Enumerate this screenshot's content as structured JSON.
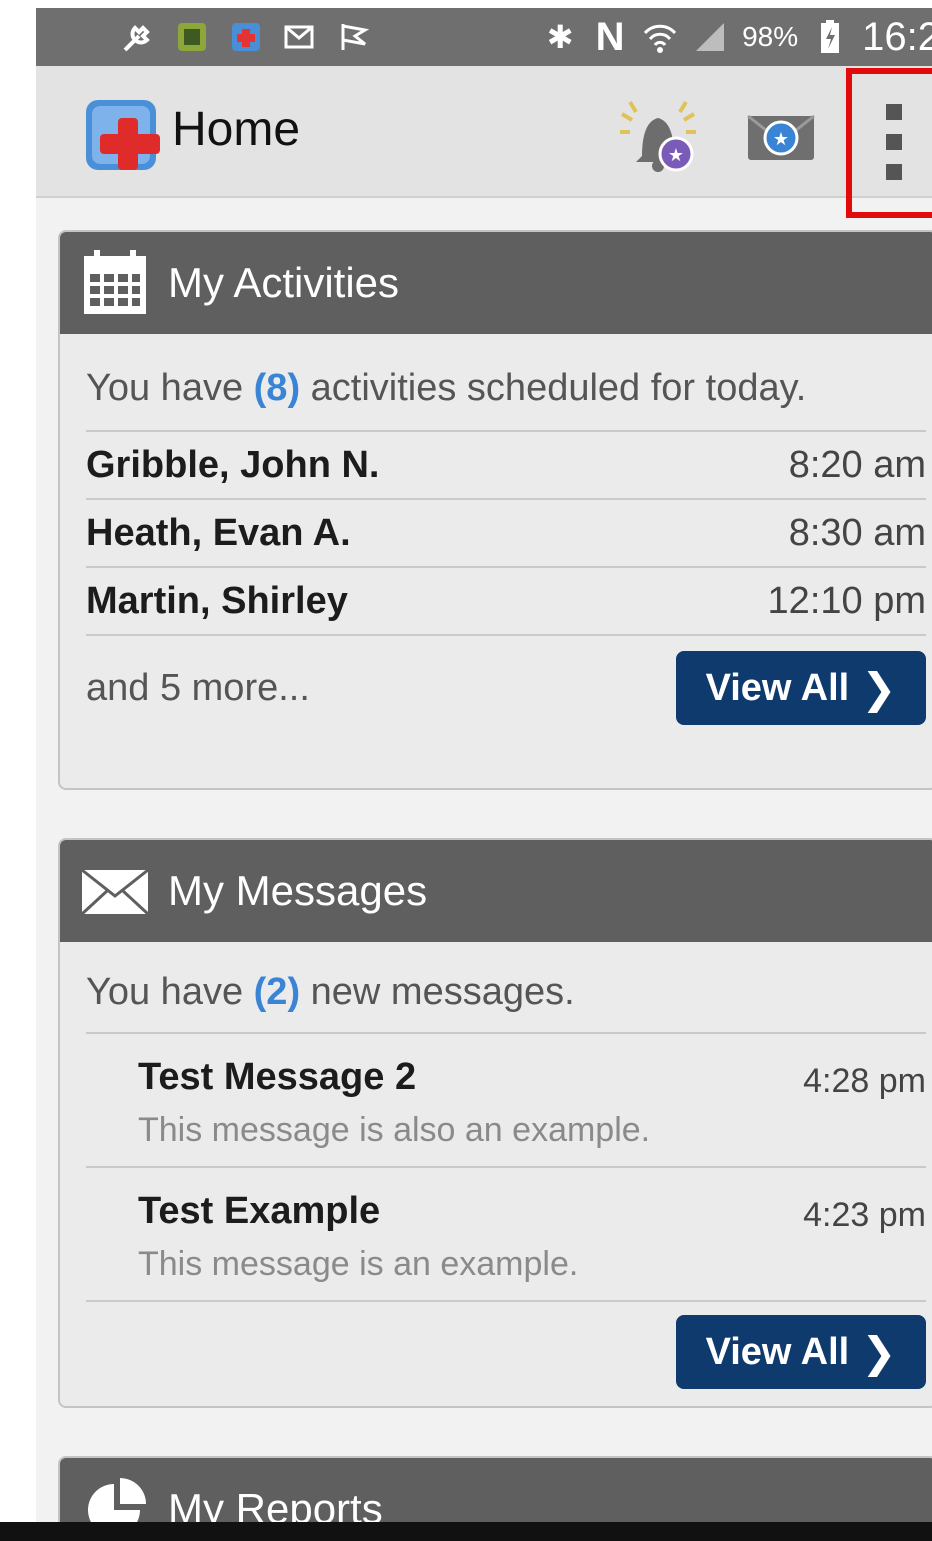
{
  "status_bar": {
    "battery": "98%",
    "time": "16:2"
  },
  "action_bar": {
    "title": "Home",
    "alerts_icon": "bell-alert-icon",
    "messages_icon": "mail-icon",
    "overflow_icon": "more-vertical-icon"
  },
  "activities": {
    "title": "My Activities",
    "summary_prefix": "You have ",
    "summary_count": "(8)",
    "summary_suffix": " activities scheduled for today.",
    "items": [
      {
        "name": "Gribble, John N.",
        "time": "8:20 am"
      },
      {
        "name": "Heath, Evan A.",
        "time": "8:30 am"
      },
      {
        "name": "Martin, Shirley",
        "time": "12:10 pm"
      }
    ],
    "more_text": "and 5 more...",
    "view_all_label": "View All"
  },
  "messages": {
    "title": "My Messages",
    "summary_prefix": "You have ",
    "summary_count": "(2)",
    "summary_suffix": " new messages.",
    "items": [
      {
        "subject": "Test Message 2",
        "time": "4:28 pm",
        "preview": "This message is also an example."
      },
      {
        "subject": "Test Example",
        "time": "4:23 pm",
        "preview": "This message is an example."
      }
    ],
    "view_all_label": "View All"
  },
  "reports": {
    "title": "My Reports"
  },
  "colors": {
    "header_gray": "#5f5f5f",
    "button_navy": "#0f3a6e",
    "count_blue": "#3a84d6",
    "highlight_red": "#e10b0b"
  }
}
